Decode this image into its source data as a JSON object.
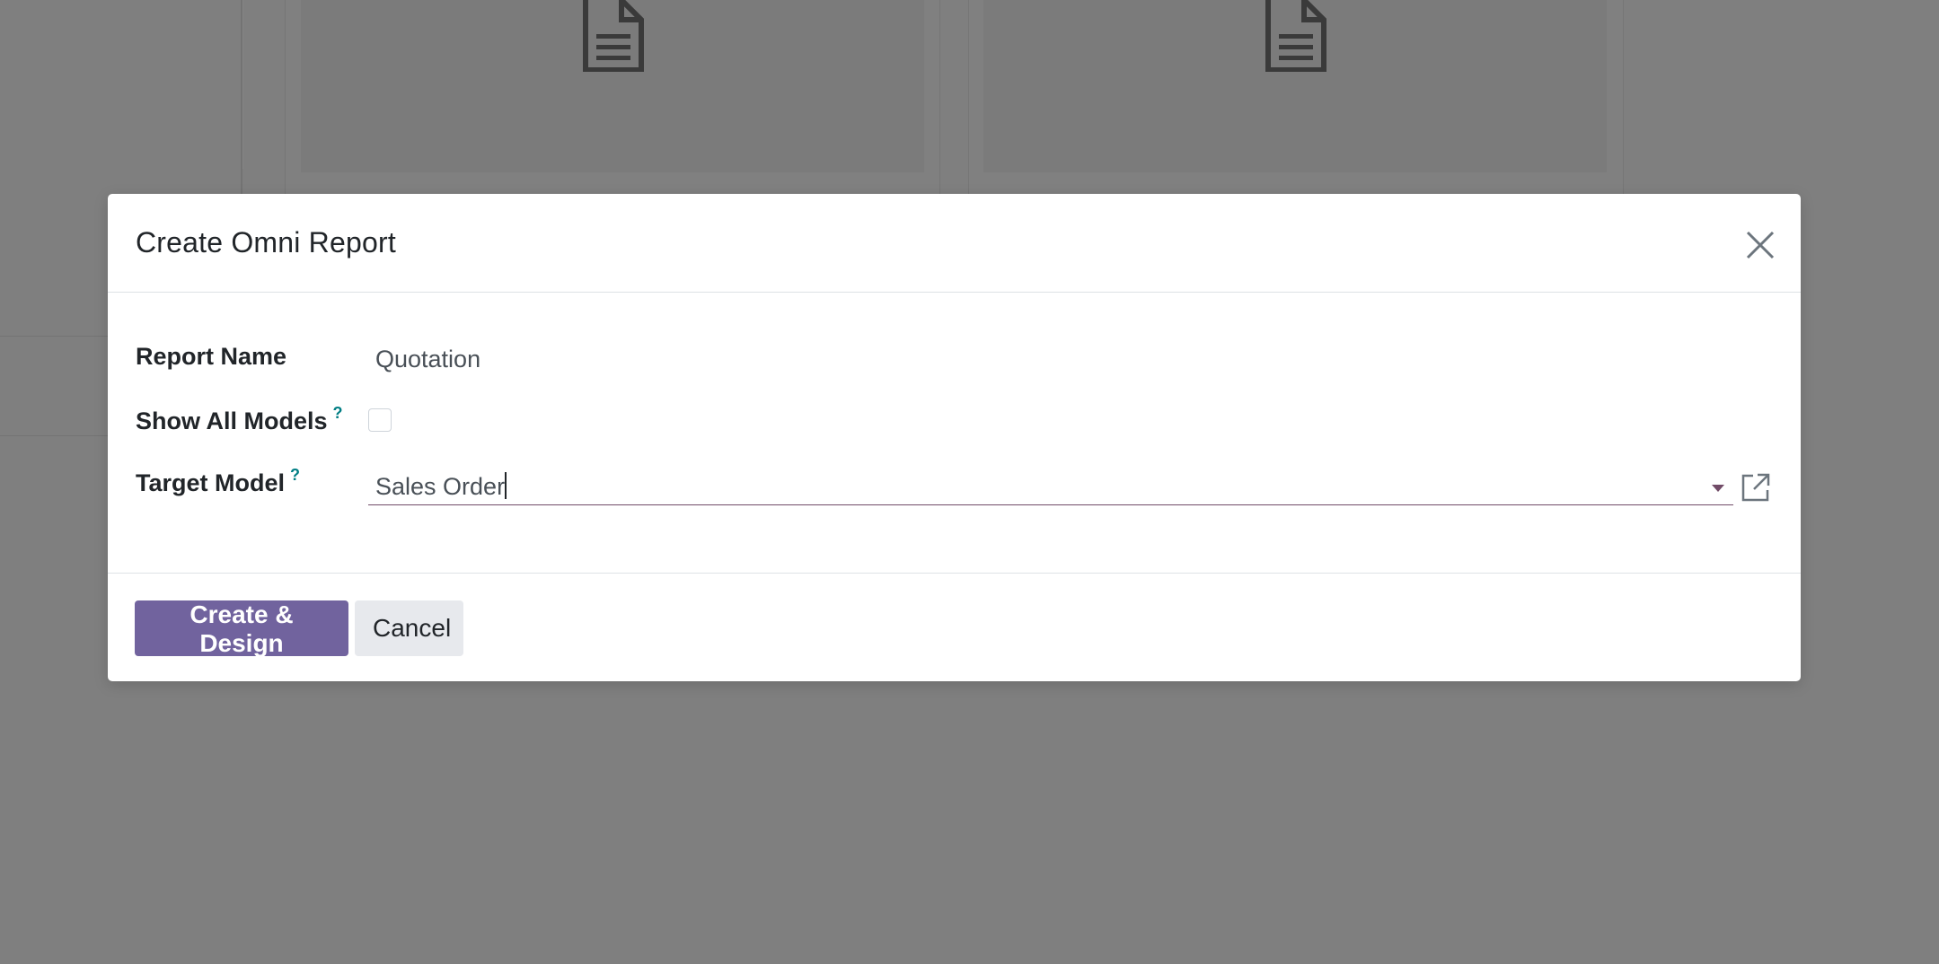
{
  "dialog": {
    "title": "Create Omni Report",
    "close_icon": "close-icon"
  },
  "form": {
    "report_name": {
      "label": "Report Name",
      "value": "Quotation"
    },
    "show_all_models": {
      "label": "Show All Models",
      "help": "?",
      "checked": false
    },
    "target_model": {
      "label": "Target Model",
      "help": "?",
      "value": "Sales Order",
      "dropdown_icon": "caret-down-icon",
      "external_icon": "external-link-icon"
    }
  },
  "footer": {
    "create_label": "Create & Design",
    "cancel_label": "Cancel"
  },
  "colors": {
    "primary": "#71639e",
    "accent_border": "#714b67",
    "help": "#017e84",
    "backdrop": "#7f7f7f"
  }
}
